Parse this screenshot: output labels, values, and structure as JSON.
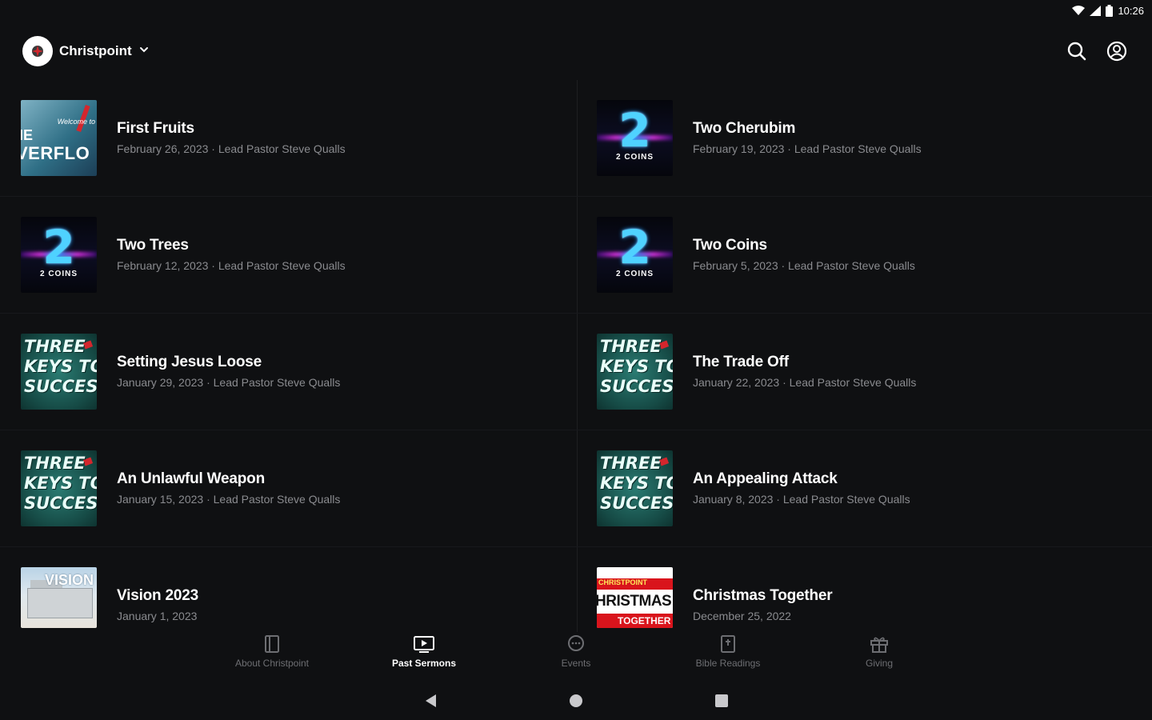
{
  "status_bar": {
    "time": "10:26"
  },
  "app_bar": {
    "church_name": "Christpoint",
    "logo_icon": "christpoint-logo-icon",
    "actions": [
      "search-icon",
      "account-icon"
    ]
  },
  "sermons": [
    {
      "title": "First Fruits",
      "meta": "February 26, 2023 · Lead Pastor Steve Qualls",
      "thumb": "overflow"
    },
    {
      "title": "Two Cherubim",
      "meta": "February 19, 2023 · Lead Pastor Steve Qualls",
      "thumb": "2coins"
    },
    {
      "title": "Two Trees",
      "meta": "February 12, 2023 · Lead Pastor Steve Qualls",
      "thumb": "2coins"
    },
    {
      "title": "Two Coins",
      "meta": "February 5, 2023 · Lead Pastor Steve Qualls",
      "thumb": "2coins"
    },
    {
      "title": "Setting Jesus Loose",
      "meta": "January 29, 2023 · Lead Pastor Steve Qualls",
      "thumb": "keys"
    },
    {
      "title": "The Trade Off",
      "meta": "January 22, 2023 · Lead Pastor Steve Qualls",
      "thumb": "keys"
    },
    {
      "title": "An Unlawful Weapon",
      "meta": "January 15, 2023 · Lead Pastor Steve Qualls",
      "thumb": "keys"
    },
    {
      "title": "An Appealing Attack",
      "meta": "January 8, 2023 · Lead Pastor Steve Qualls",
      "thumb": "keys"
    },
    {
      "title": "Vision 2023",
      "meta": "January 1, 2023",
      "thumb": "vision"
    },
    {
      "title": "Christmas Together",
      "meta": "December 25, 2022",
      "thumb": "xmas"
    }
  ],
  "thumb_text": {
    "two_number": "2",
    "two_caption": "2 COINS",
    "keys_line1": "THREE",
    "keys_line2": "KEYS TO",
    "keys_line3": "SUCCESS",
    "overflow_he": "IE",
    "overflow_big": "VERFLO",
    "overflow_script": "Welcome to",
    "vision_title": "VISION",
    "xmas_top": "CHRISTPOINT",
    "xmas_mid": "HRISTMAS",
    "xmas_bottom": "TOGETHER"
  },
  "bottom_nav": [
    {
      "label": "About Christpoint",
      "icon": "book-icon",
      "active": false
    },
    {
      "label": "Past Sermons",
      "icon": "tv-play-icon",
      "active": true
    },
    {
      "label": "Events",
      "icon": "chat-bubble-icon",
      "active": false
    },
    {
      "label": "Bible Readings",
      "icon": "bible-icon",
      "active": false
    },
    {
      "label": "Giving",
      "icon": "gift-icon",
      "active": false
    }
  ],
  "colors": {
    "background": "#0f1012",
    "text_primary": "#ffffff",
    "text_secondary": "#8a8b8f",
    "nav_inactive": "#6d6e72",
    "divider": "#1d1e21"
  }
}
